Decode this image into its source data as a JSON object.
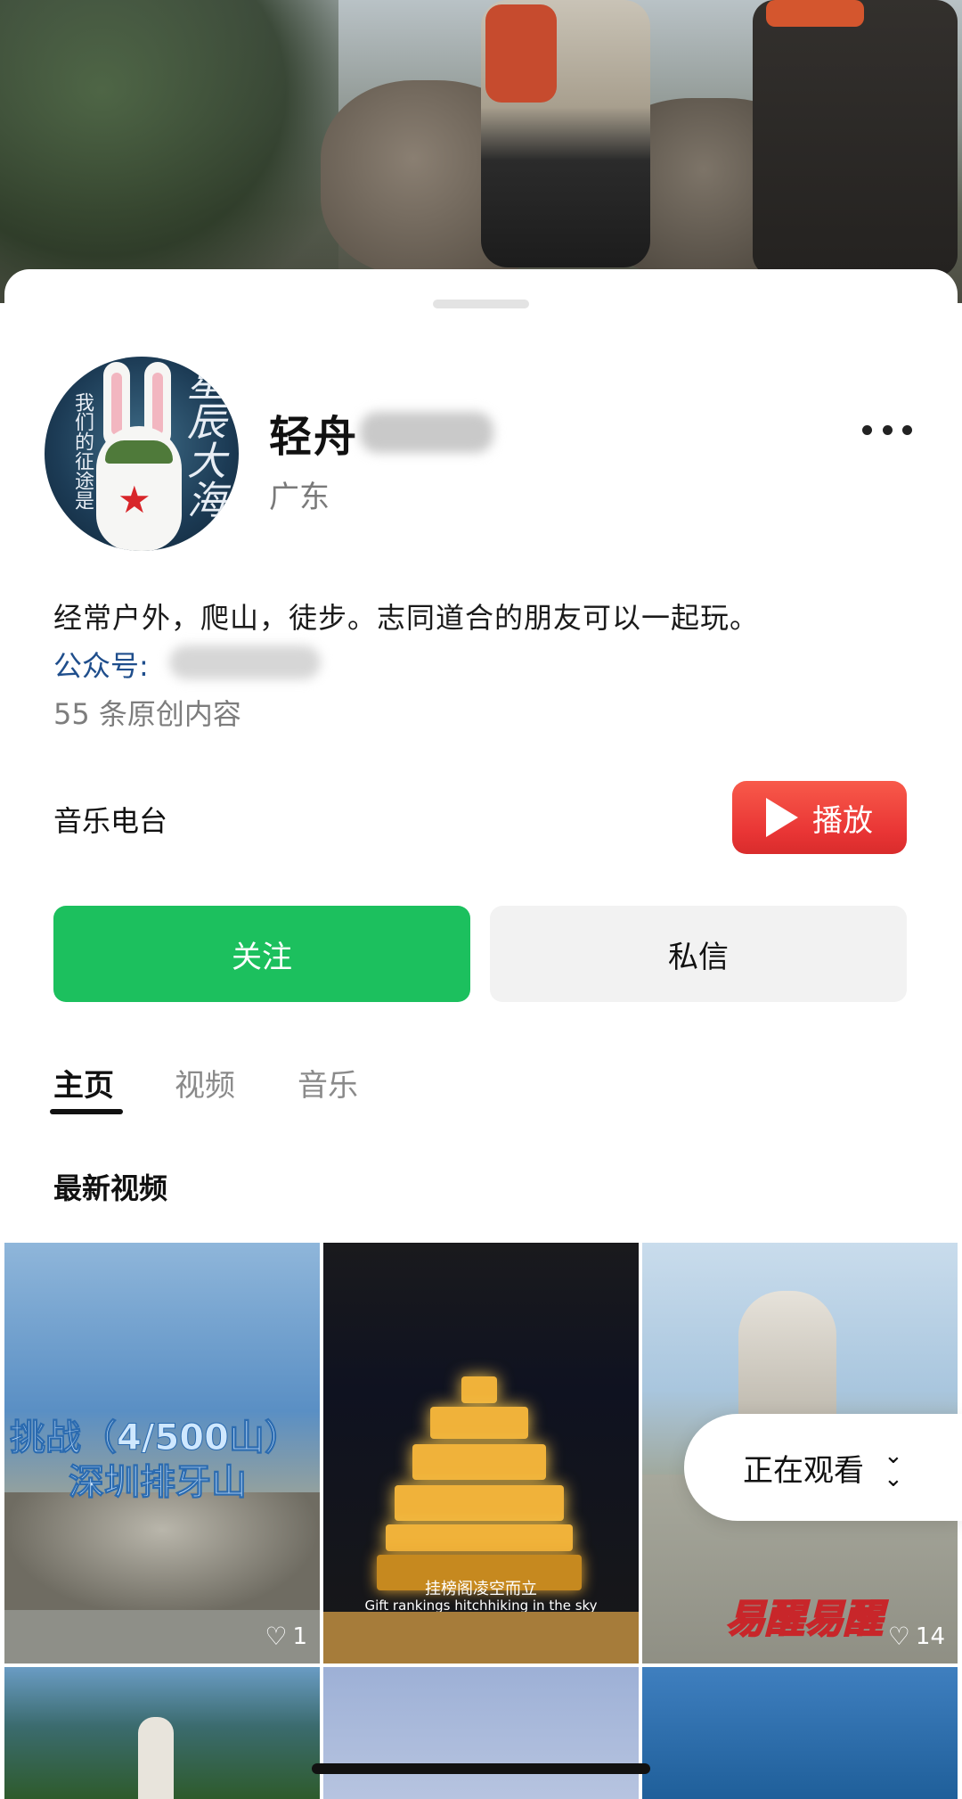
{
  "profile": {
    "name": "轻舟",
    "region": "广东",
    "bio": "经常户外，爬山，徒步。志同道合的朋友可以一起玩。",
    "public_account_label": "公众号:",
    "original_count": "55 条原创内容",
    "avatar_text_main": "星辰大海",
    "avatar_text_side": "我们的征途是"
  },
  "radio": {
    "label": "音乐电台",
    "play_label": "播放"
  },
  "actions": {
    "follow": "关注",
    "message": "私信"
  },
  "tabs": [
    "主页",
    "视频",
    "音乐"
  ],
  "section_title": "最新视频",
  "videos": [
    {
      "caption_line1": "挑战（4/500山）",
      "caption_line2": "深圳排牙山",
      "likes": "1"
    },
    {
      "caption_cn": "挂榜阁凌空而立",
      "caption_en": "Gift rankings hitchhiking in the sky",
      "likes": ""
    },
    {
      "caption": "易醒易醒",
      "likes": "14"
    }
  ],
  "now_watching": "正在观看",
  "colors": {
    "follow_green": "#1cc05e",
    "play_red": "#e93535",
    "public_account_blue": "#1f4e8c"
  }
}
